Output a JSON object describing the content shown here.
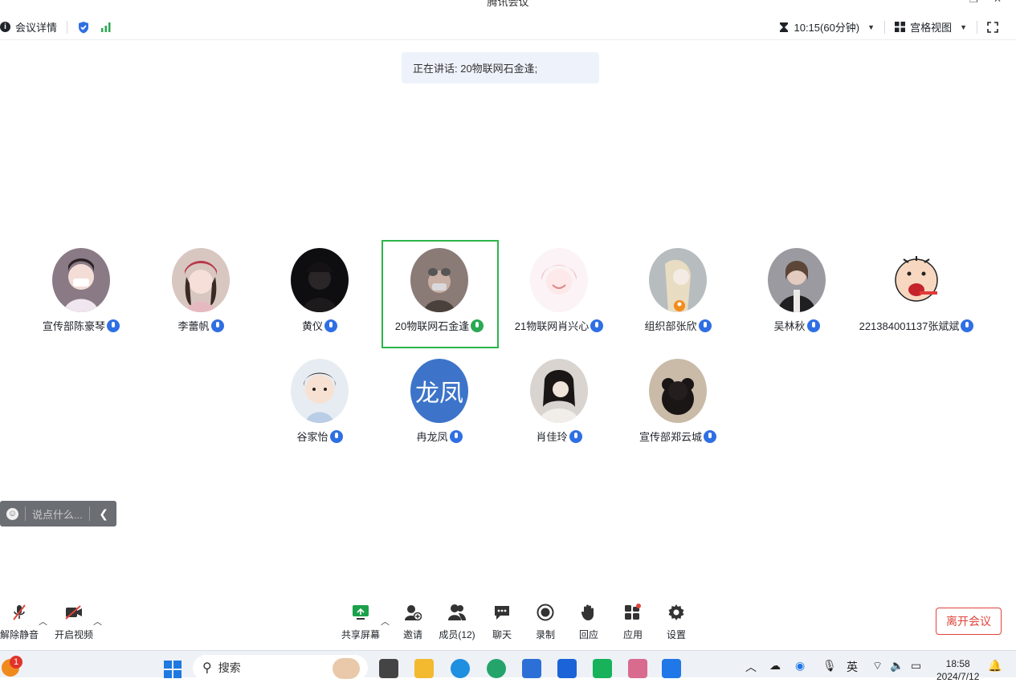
{
  "window": {
    "title": "腾讯会议"
  },
  "topbar": {
    "details_label": "会议详情",
    "timer": "10:15(60分钟)",
    "view_label": "宫格视图"
  },
  "speaking": {
    "text": "正在讲话: 20物联网石金逢;"
  },
  "participants": [
    {
      "name": "宣传部陈豪琴"
    },
    {
      "name": "李蕾帆"
    },
    {
      "name": "黄仪"
    },
    {
      "name": "20物联网石金逢"
    },
    {
      "name": "21物联网肖兴心"
    },
    {
      "name": "组织部张欣"
    },
    {
      "name": "吴林秋"
    },
    {
      "name": "221384001137张斌斌"
    },
    {
      "name": "谷家怡"
    },
    {
      "name": "冉龙凤",
      "avatar_text": "龙凤"
    },
    {
      "name": "肖佳玲"
    },
    {
      "name": "宣传部郑云城"
    }
  ],
  "chat": {
    "placeholder": "说点什么..."
  },
  "toolbar": {
    "unmute": "解除静音",
    "start_video": "开启视频",
    "share_screen": "共享屏幕",
    "invite": "邀请",
    "members": "成员(12)",
    "chat": "聊天",
    "record": "录制",
    "reactions": "回应",
    "apps": "应用",
    "settings": "设置",
    "leave": "离开会议"
  },
  "taskbar": {
    "notification_count": "1",
    "search_placeholder": "搜索",
    "ime": "英",
    "time": "18:58",
    "date": "2024/7/12"
  }
}
